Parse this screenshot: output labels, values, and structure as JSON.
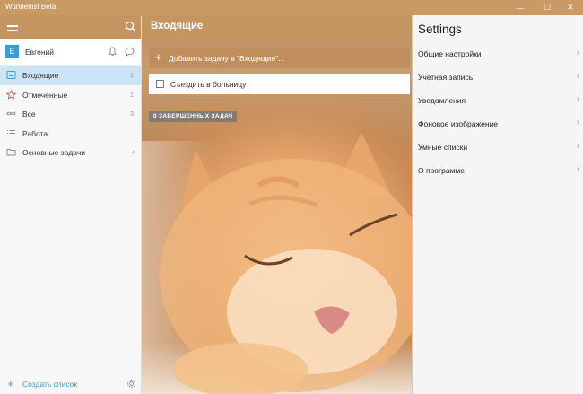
{
  "window": {
    "title": "Wunderlist Beta",
    "min_label": "—",
    "max_label": "☐",
    "close_label": "✕"
  },
  "sidebar": {
    "user_initial": "E",
    "user_name": "Евгений",
    "items": [
      {
        "label": "Входящие",
        "count": "1",
        "icon": "inbox-icon",
        "active": true
      },
      {
        "label": "Отмеченные",
        "count": "1",
        "icon": "star-icon"
      },
      {
        "label": "Все",
        "count": "3",
        "icon": "infinity-icon"
      },
      {
        "label": "Работа",
        "count": "",
        "icon": "list-icon"
      },
      {
        "label": "Основные задачи",
        "count": "",
        "icon": "folder-icon"
      }
    ],
    "folder_chevron": "‹",
    "create_list_label": "Создать список"
  },
  "main": {
    "title": "Входящие",
    "add_task_placeholder": "Добавить задачу в \"Входящие\"...",
    "tasks": [
      {
        "label": "Съездить в больницу",
        "done": false
      }
    ],
    "completed_label": "0 ЗАВЕРШЕННЫХ ЗАДАЧ"
  },
  "settings": {
    "title": "Settings",
    "items": [
      {
        "label": "Общие настройки"
      },
      {
        "label": "Учетная запись"
      },
      {
        "label": "Уведомления"
      },
      {
        "label": "Фоновое изображение"
      },
      {
        "label": "Умные списки"
      },
      {
        "label": "О программе"
      }
    ],
    "chevron": "›"
  },
  "colors": {
    "header_bg": "#c49560",
    "accent_blue": "#3c9cd2",
    "active_item_bg": "#cde4f7",
    "star_red": "#e04a3f"
  }
}
